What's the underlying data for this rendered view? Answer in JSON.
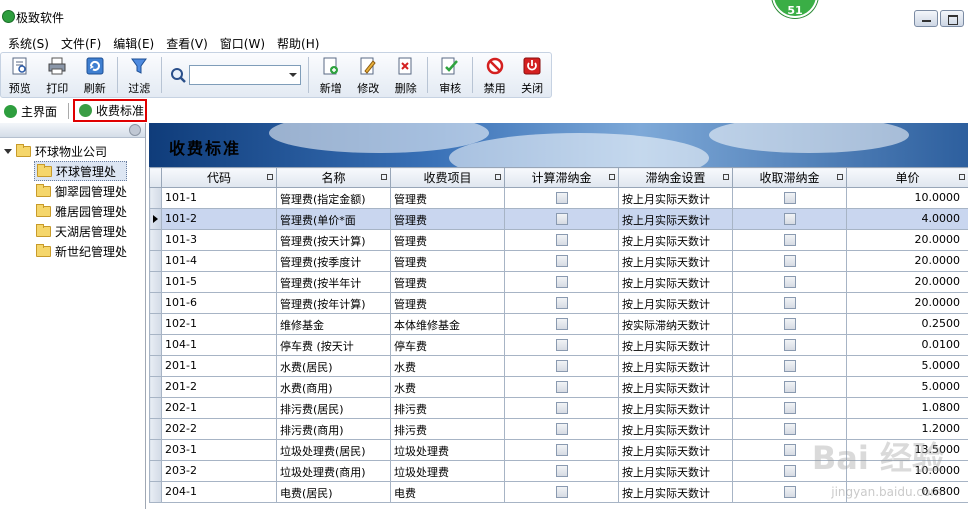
{
  "window": {
    "title": "极致软件",
    "badge": "51"
  },
  "menu": [
    "系统(S)",
    "文件(F)",
    "编辑(E)",
    "查看(V)",
    "窗口(W)",
    "帮助(H)"
  ],
  "toolbar": {
    "preview": "预览",
    "print": "打印",
    "refresh": "刷新",
    "filter": "过滤",
    "search_value": "",
    "add": "新增",
    "edit": "修改",
    "delete": "删除",
    "audit": "审核",
    "disable": "禁用",
    "close": "关闭"
  },
  "tabs": {
    "main": "主界面",
    "fee": "收费标准"
  },
  "tree": {
    "root": "环球物业公司",
    "children": [
      "环球管理处",
      "御翠园管理处",
      "雅居园管理处",
      "天湖居管理处",
      "新世纪管理处"
    ]
  },
  "banner": {
    "title": "收费标准"
  },
  "grid": {
    "headers": [
      "代码",
      "名称",
      "收费项目",
      "计算滞纳金",
      "滞纳金设置",
      "收取滞纳金",
      "单价"
    ],
    "rows": [
      {
        "code": "101-1",
        "name": "管理费(指定金额)",
        "item": "管理费",
        "setting": "按上月实际天数计",
        "price": "10.0000"
      },
      {
        "code": "101-2",
        "name": "管理费(单价*面",
        "item": "管理费",
        "setting": "按上月实际天数计",
        "price": "4.0000"
      },
      {
        "code": "101-3",
        "name": "管理费(按天计算)",
        "item": "管理费",
        "setting": "按上月实际天数计",
        "price": "20.0000"
      },
      {
        "code": "101-4",
        "name": "管理费(按季度计",
        "item": "管理费",
        "setting": "按上月实际天数计",
        "price": "20.0000"
      },
      {
        "code": "101-5",
        "name": "管理费(按半年计",
        "item": "管理费",
        "setting": "按上月实际天数计",
        "price": "20.0000"
      },
      {
        "code": "101-6",
        "name": "管理费(按年计算)",
        "item": "管理费",
        "setting": "按上月实际天数计",
        "price": "20.0000"
      },
      {
        "code": "102-1",
        "name": "维修基金",
        "item": "本体维修基金",
        "setting": "按实际滞纳天数计",
        "price": "0.2500"
      },
      {
        "code": "104-1",
        "name": "停车费 (按天计",
        "item": "停车费",
        "setting": "按上月实际天数计",
        "price": "0.0100"
      },
      {
        "code": "201-1",
        "name": "水费(居民)",
        "item": "水费",
        "setting": "按上月实际天数计",
        "price": "5.0000"
      },
      {
        "code": "201-2",
        "name": "水费(商用)",
        "item": "水费",
        "setting": "按上月实际天数计",
        "price": "5.0000"
      },
      {
        "code": "202-1",
        "name": "排污费(居民)",
        "item": "排污费",
        "setting": "按上月实际天数计",
        "price": "1.0800"
      },
      {
        "code": "202-2",
        "name": "排污费(商用)",
        "item": "排污费",
        "setting": "按上月实际天数计",
        "price": "1.2000"
      },
      {
        "code": "203-1",
        "name": "垃圾处理费(居民)",
        "item": "垃圾处理费",
        "setting": "按上月实际天数计",
        "price": "13.5000"
      },
      {
        "code": "203-2",
        "name": "垃圾处理费(商用)",
        "item": "垃圾处理费",
        "setting": "按上月实际天数计",
        "price": "10.0000"
      },
      {
        "code": "204-1",
        "name": "电费(居民)",
        "item": "电费",
        "setting": "按上月实际天数计",
        "price": "0.6800"
      }
    ],
    "selected_index": 1
  },
  "watermark": {
    "main": "Bai 经验",
    "sub": "jingyan.baidu.com"
  }
}
